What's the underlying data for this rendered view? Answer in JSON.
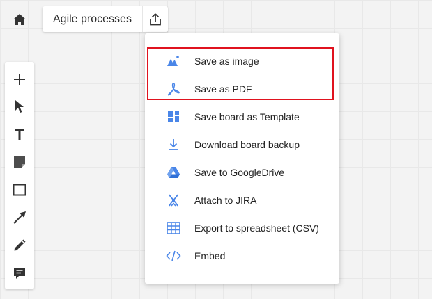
{
  "header": {
    "board_title": "Agile processes"
  },
  "icons": {
    "home": "home-icon",
    "export": "upload-icon"
  },
  "toolbar": {
    "tools": [
      "plus-icon",
      "cursor-icon",
      "text-icon",
      "sticky-note-icon",
      "rectangle-icon",
      "arrow-icon",
      "pen-icon",
      "comment-icon"
    ]
  },
  "export_menu": {
    "items": [
      {
        "label": "Save as image",
        "icon": "image-icon"
      },
      {
        "label": "Save as PDF",
        "icon": "pdf-icon"
      },
      {
        "label": "Save board as Template",
        "icon": "template-icon"
      },
      {
        "label": "Download board backup",
        "icon": "download-icon"
      },
      {
        "label": "Save to GoogleDrive",
        "icon": "google-drive-icon"
      },
      {
        "label": "Attach to JIRA",
        "icon": "jira-icon"
      },
      {
        "label": "Export to spreadsheet (CSV)",
        "icon": "spreadsheet-icon"
      },
      {
        "label": "Embed",
        "icon": "embed-icon"
      }
    ]
  },
  "colors": {
    "accent_blue": "#4a86e8",
    "highlight_red": "#e0131f",
    "icon_dark": "#333333"
  }
}
